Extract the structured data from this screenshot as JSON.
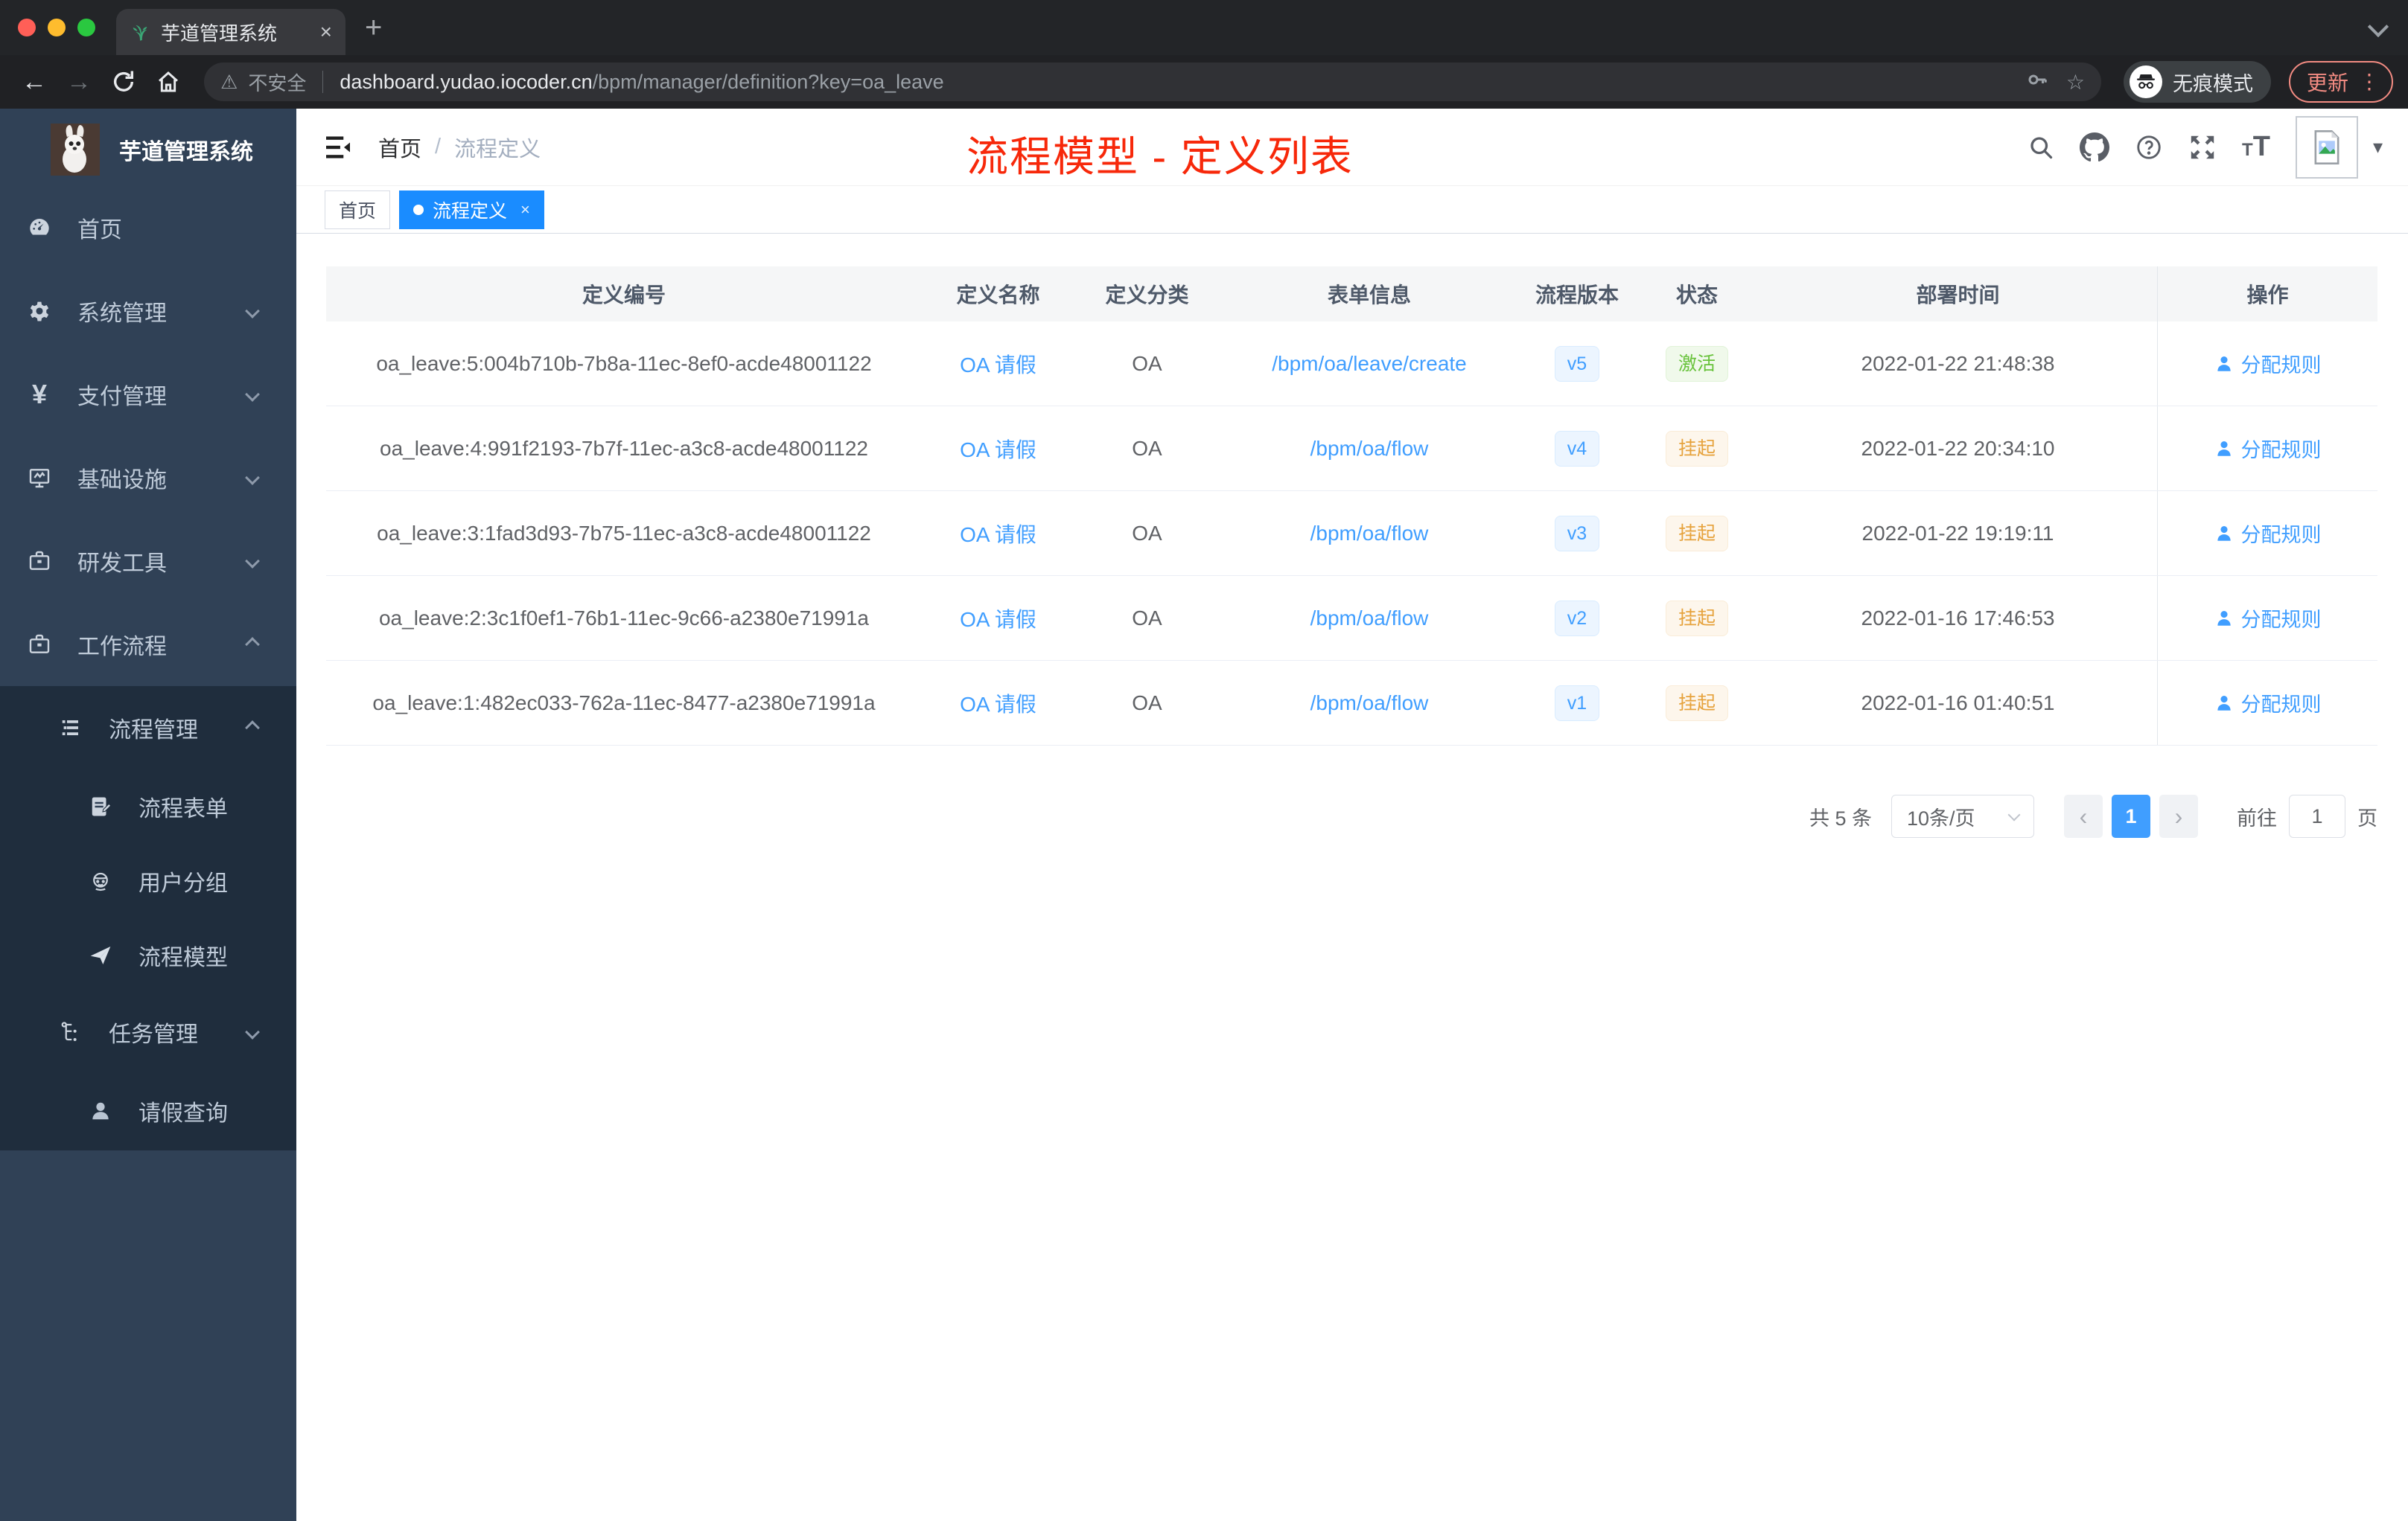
{
  "browser": {
    "tab_title": "芋道管理系统",
    "new_tab_label": "+",
    "close_label": "×",
    "security_label": "不安全",
    "url_host": "dashboard.yudao.iocoder.cn",
    "url_path": "/bpm/manager/definition?key=oa_leave",
    "incognito_label": "无痕模式",
    "update_label": "更新",
    "menu_dots": "⋮"
  },
  "sidebar": {
    "logo_title": "芋道管理系统",
    "items": [
      {
        "label": "首页",
        "icon": "dashboard-icon"
      },
      {
        "label": "系统管理",
        "icon": "gear-icon",
        "chevron": "down"
      },
      {
        "label": "支付管理",
        "icon": "yen-icon",
        "chevron": "down"
      },
      {
        "label": "基础设施",
        "icon": "monitor-icon",
        "chevron": "down"
      },
      {
        "label": "研发工具",
        "icon": "toolbox-icon",
        "chevron": "down"
      },
      {
        "label": "工作流程",
        "icon": "briefcase-icon",
        "chevron": "up"
      },
      {
        "label": "流程管理",
        "icon": "list-icon",
        "chevron": "up"
      },
      {
        "label": "流程表单",
        "icon": "form-icon"
      },
      {
        "label": "用户分组",
        "icon": "user-group-icon"
      },
      {
        "label": "流程模型",
        "icon": "paper-plane-icon"
      },
      {
        "label": "任务管理",
        "icon": "tree-icon",
        "chevron": "down"
      },
      {
        "label": "请假查询",
        "icon": "person-icon"
      }
    ]
  },
  "header": {
    "breadcrumb_home": "首页",
    "breadcrumb_sep": "/",
    "breadcrumb_current": "流程定义",
    "annotation": "流程模型 - 定义列表"
  },
  "tags": {
    "home": "首页",
    "active": "流程定义",
    "active_close": "×"
  },
  "table": {
    "columns": [
      "定义编号",
      "定义名称",
      "定义分类",
      "表单信息",
      "流程版本",
      "状态",
      "部署时间",
      "操作"
    ],
    "action_label": "分配规则",
    "rows": [
      {
        "id": "oa_leave:5:004b710b-7b8a-11ec-8ef0-acde48001122",
        "name": "OA 请假",
        "category": "OA",
        "form": "/bpm/oa/leave/create",
        "version": "v5",
        "status": "激活",
        "status_type": "success",
        "time": "2022-01-22 21:48:38"
      },
      {
        "id": "oa_leave:4:991f2193-7b7f-11ec-a3c8-acde48001122",
        "name": "OA 请假",
        "category": "OA",
        "form": "/bpm/oa/flow",
        "version": "v4",
        "status": "挂起",
        "status_type": "warning",
        "time": "2022-01-22 20:34:10"
      },
      {
        "id": "oa_leave:3:1fad3d93-7b75-11ec-a3c8-acde48001122",
        "name": "OA 请假",
        "category": "OA",
        "form": "/bpm/oa/flow",
        "version": "v3",
        "status": "挂起",
        "status_type": "warning",
        "time": "2022-01-22 19:19:11"
      },
      {
        "id": "oa_leave:2:3c1f0ef1-76b1-11ec-9c66-a2380e71991a",
        "name": "OA 请假",
        "category": "OA",
        "form": "/bpm/oa/flow",
        "version": "v2",
        "status": "挂起",
        "status_type": "warning",
        "time": "2022-01-16 17:46:53"
      },
      {
        "id": "oa_leave:1:482ec033-762a-11ec-8477-a2380e71991a",
        "name": "OA 请假",
        "category": "OA",
        "form": "/bpm/oa/flow",
        "version": "v1",
        "status": "挂起",
        "status_type": "warning",
        "time": "2022-01-16 01:40:51"
      }
    ]
  },
  "pagination": {
    "total": "共 5 条",
    "page_size": "10条/页",
    "prev": "‹",
    "page": "1",
    "next": "›",
    "goto_label": "前往",
    "goto_value": "1",
    "page_unit": "页"
  },
  "colors": {
    "accent_blue": "#409eff",
    "tag_active_blue": "#1a8cff",
    "annotation_red": "#f7280a",
    "sidebar_bg": "#304156",
    "submenu_bg": "#1f2d3d",
    "success_green": "#67c23a",
    "warning_orange": "#e6a23c"
  }
}
